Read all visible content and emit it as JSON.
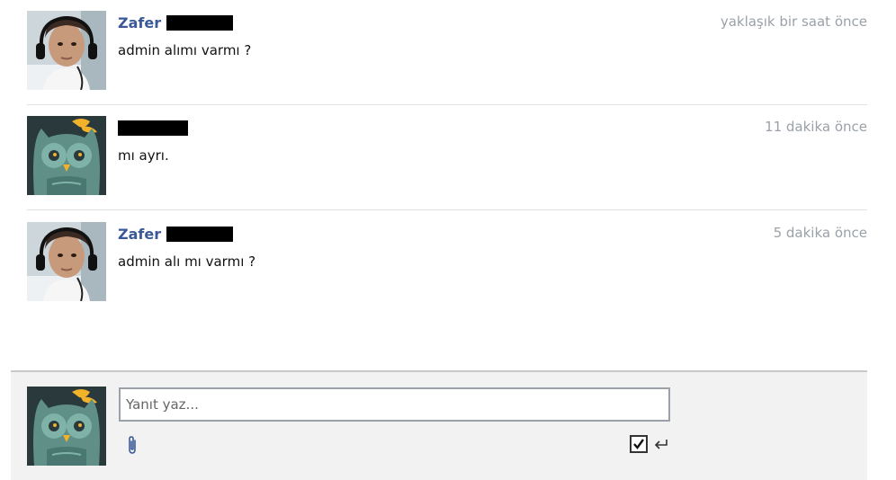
{
  "messages": [
    {
      "sender": "Zafer",
      "avatar": "user-photo-headphones",
      "text": "admin alımı varmı ?",
      "time": "yaklaşık bir saat önce"
    },
    {
      "sender": "",
      "avatar": "owl-avatar",
      "text": "mı ayrı.",
      "time": "11 dakika önce"
    },
    {
      "sender": "Zafer",
      "avatar": "user-photo-headphones",
      "text": "admin alı mı varmı ?",
      "time": "5 dakika önce"
    }
  ],
  "reply": {
    "placeholder": "Yanıt yaz...",
    "avatar": "owl-avatar",
    "attach_icon": "paperclip-icon",
    "enter_icon": "enter-arrow-icon",
    "send_on_enter_checked": true
  },
  "colors": {
    "sender_name": "#3b5998",
    "timestamp": "#9aa1a8",
    "reply_bg": "#f2f2f2"
  }
}
